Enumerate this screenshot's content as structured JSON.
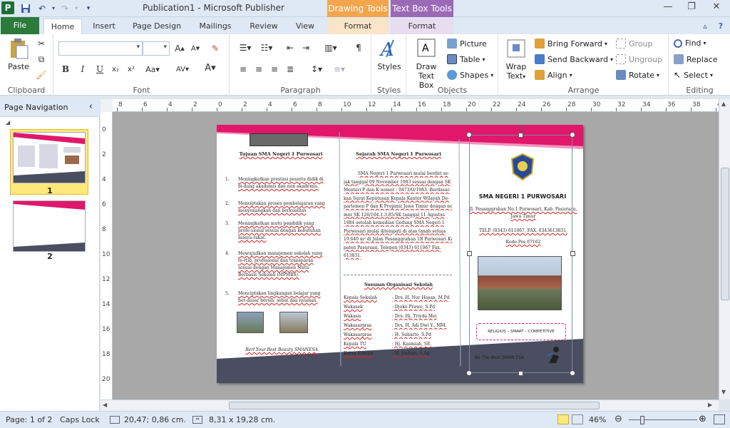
{
  "window": {
    "title": "Publication1 - Microsoft Publisher",
    "context_drawing": "Drawing Tools",
    "context_textbox": "Text Box Tools"
  },
  "tabs": {
    "file": "File",
    "home": "Home",
    "insert": "Insert",
    "page_design": "Page Design",
    "mailings": "Mailings",
    "review": "Review",
    "view": "View",
    "format1": "Format",
    "format2": "Format"
  },
  "ribbon": {
    "clipboard": {
      "label": "Clipboard",
      "paste": "Paste"
    },
    "font": {
      "label": "Font"
    },
    "paragraph": {
      "label": "Paragraph"
    },
    "styles": {
      "label": "Styles",
      "button": "Styles"
    },
    "objects": {
      "label": "Objects",
      "draw_text_box_1": "Draw",
      "draw_text_box_2": "Text Box",
      "picture": "Picture",
      "table": "Table",
      "shapes": "Shapes"
    },
    "arrange": {
      "label": "Arrange",
      "wrap_text_1": "Wrap",
      "wrap_text_2": "Text",
      "bring_forward": "Bring Forward",
      "send_backward": "Send Backward",
      "align": "Align",
      "group": "Group",
      "ungroup": "Ungroup",
      "rotate": "Rotate"
    },
    "editing": {
      "label": "Editing",
      "find": "Find",
      "replace": "Replace",
      "select": "Select"
    }
  },
  "nav": {
    "title": "Page Navigation",
    "page1": "1",
    "page2": "2"
  },
  "ruler": {
    "h": [
      "8",
      "6",
      "4",
      "2",
      "0",
      "2",
      "4",
      "6",
      "8",
      "10",
      "12",
      "14",
      "16",
      "18",
      "20",
      "22",
      "24",
      "26",
      "28",
      "30",
      "32",
      "34",
      "36",
      "38",
      "40"
    ],
    "v": [
      "0",
      "2",
      "4",
      "6",
      "8",
      "10",
      "12",
      "14",
      "16",
      "18",
      "20"
    ]
  },
  "document": {
    "col1": {
      "title": "Tujuan SMA Negeri 1 Purwosari",
      "items": [
        "Meningkatkan prestasi peserta didik di bi-dang akademis dan non akademis.",
        "Menciptakan proses pembelajaran yang menyenangkan dan berkualitas",
        "Meningkatkan mutu pendidik yang profe-sional sesuai dengan kebutuhan masya-rakat.",
        "Mewujudkan manajemen sekolah yang te-rtib, profesional dan transparan sesuai dengan Manajemen Mutu Berbasis Sekolah (MPMBS).",
        "Menciptakan lingkungan belajar yang ber-dasar bersih, sehat dan nyaman."
      ],
      "footer": "Berl Your Best Beauty SMANESA"
    },
    "col2": {
      "title": "Sejarah SMA Negeri 1 Purwosari",
      "history": [
        "SMA Negeri 1 Purwosari mulai berdiri se-",
        "jak tanggal 09 November 1983 sesuai dengan SK",
        "Menteri P dan K nomor : 0473/O/1983. Berdasar-",
        "kan Surat Keputusan Kepala Kantor Wilayah De-",
        "partemen P dan K Propinsi Jawa Timur dengan no-",
        "mor SK 126/104.1.3.85/SK tanggal 11 Agustus",
        "1984 setelah kemudian Gedung SMA Negeri 1",
        "Purwosari mulai ditempati di atas tanah seluas",
        "19.640 m² di Jalan Pesanggrahan 1B Purwosari Kabu-",
        "paten Pasuruan. Telepon (0343) 611067 Fax.",
        "613831."
      ],
      "org_title": "Susunan Organisasi Sekolah",
      "org": [
        {
          "role": "Kepala Sekolah",
          "name": ": Drs. H. Nur Hasan, M.Pd"
        },
        {
          "role": "Wakasek",
          "name": ": Djoko Prawo, S.Pd"
        },
        {
          "role": "Wakasis",
          "name": ": Drs. Hj. Triyda Mei"
        },
        {
          "role": "Wakasarpras",
          "name": ": Drs. H. Adi Dwi Y., MM."
        },
        {
          "role": "Wakasarpras",
          "name": ": H. Suharto, S.Pd"
        },
        {
          "role": "Kepala TU",
          "name": ": Hj. Kasmiah, SE."
        },
        {
          "role": "Ketua Komite",
          "name": ": H. Juchari, S.Ag"
        }
      ]
    },
    "col3": {
      "school": "SMA NEGERI 1 PURWOSARI",
      "address1": "Jl. Pesanggrahan No.1 Purwosari, Kab. Pasuruan,",
      "address2": "Jawa Timur",
      "phone": "TELP. (0343) 611067, FAX. 0343613831,",
      "postal": "Kode Pos 67162",
      "motto": "RELIGIUS – SMART – COMPETITIVE",
      "slogan": "Be The Best SMAN ESA"
    }
  },
  "status": {
    "page": "Page: 1 of 2",
    "caps": "Caps Lock",
    "position": "20,47; 0,86 cm.",
    "size": "8,31 x 19,28 cm.",
    "zoom": "46%"
  },
  "colors": {
    "pink": "#e0176a",
    "dark_band": "#4a4e60",
    "file_tab": "#2c7a3c",
    "drawing_tools": "#f2a54a",
    "textbox_tools": "#9b69b6"
  }
}
